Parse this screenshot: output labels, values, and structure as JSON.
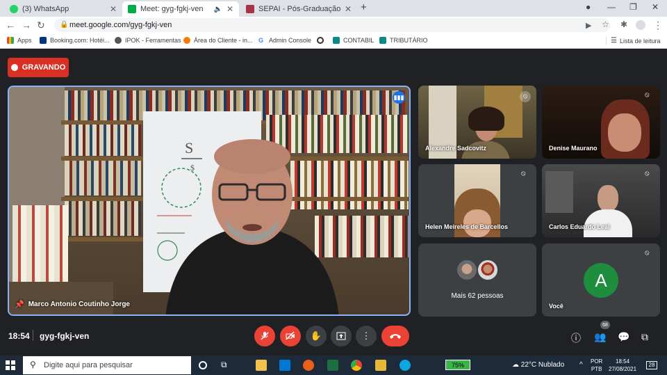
{
  "browser": {
    "tabs": [
      {
        "label": "(3) WhatsApp",
        "active": false,
        "icon": "whatsapp-icon",
        "color": "#25d366"
      },
      {
        "label": "Meet: gyg-fgkj-ven",
        "active": true,
        "icon": "meet-icon",
        "color": "#00ac47"
      },
      {
        "label": "SEPAI - Pós-Graduação em Psica",
        "active": false,
        "icon": "sepai-icon",
        "color": "#a83246"
      }
    ],
    "url": "meet.google.com/gyg-fgkj-ven",
    "bookmarks": [
      {
        "label": "Apps",
        "color": "#4285f4"
      },
      {
        "label": "Booking.com: Hotéi...",
        "color": "#003580"
      },
      {
        "label": "IPOK - Ferramentas",
        "color": "#555"
      },
      {
        "label": "Área do Cliente - in...",
        "color": "#f57c00"
      },
      {
        "label": "Admin Console",
        "color": "#4285f4"
      },
      {
        "label": "",
        "color": "#333"
      },
      {
        "label": "CONTABIL",
        "color": "#0b8a8a"
      },
      {
        "label": "TRIBUTÁRIO",
        "color": "#0b8a8a"
      }
    ],
    "reading_list": "Lista de leitura"
  },
  "meet": {
    "recording_label": "GRAVANDO",
    "main_speaker": "Marco Antonio Coutinho Jorge",
    "participants": [
      {
        "name": "Alexandre Sadcovitz",
        "muted": true
      },
      {
        "name": "Denise Maurano",
        "muted": true
      },
      {
        "name": "Helen Meireles de Barcellos",
        "muted": true
      },
      {
        "name": "Carlos Eduardo Leal",
        "muted": true
      }
    ],
    "more_people": "Mais 62 pessoas",
    "self": {
      "name": "Você",
      "initial": "A"
    },
    "time": "18:54",
    "meeting_code": "gyg-fgkj-ven",
    "participant_count": "68"
  },
  "taskbar": {
    "search_placeholder": "Digite aqui para pesquisar",
    "battery": "75%",
    "weather": "22°C  Nublado",
    "lang_top": "POR",
    "lang_bottom": "PTB",
    "clock_time": "18:54",
    "clock_date": "27/08/2021",
    "notifications": "28"
  }
}
